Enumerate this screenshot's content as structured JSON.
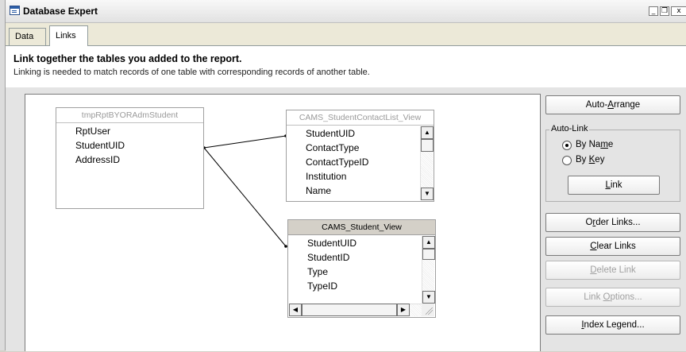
{
  "window": {
    "title": "Database Expert",
    "controls": {
      "minimize": "_",
      "restore": "❐",
      "close": "x"
    }
  },
  "tabs": [
    {
      "label": "Data",
      "active": false
    },
    {
      "label": "Links",
      "active": true
    }
  ],
  "heading": "Link together the tables you added to the report.",
  "subtext": "Linking is needed to match records of one table with corresponding records of another table.",
  "tables": [
    {
      "title": "tmpRptBYORAdmStudent",
      "fields": [
        "RptUser",
        "StudentUID",
        "AddressID"
      ]
    },
    {
      "title": "CAMS_StudentContactList_View",
      "fields": [
        "StudentUID",
        "ContactType",
        "ContactTypeID",
        "Institution",
        "Name"
      ]
    },
    {
      "title": "CAMS_Student_View",
      "fields": [
        "StudentUID",
        "StudentID",
        "Type",
        "TypeID"
      ]
    }
  ],
  "buttons": {
    "auto_arrange": {
      "pre": "Auto-",
      "key": "A",
      "post": "rrange"
    },
    "link": {
      "pre": "",
      "key": "L",
      "post": "ink"
    },
    "order_links": {
      "pre": "O",
      "key": "r",
      "post": "der Links..."
    },
    "clear_links": {
      "pre": "",
      "key": "C",
      "post": "lear Links"
    },
    "delete_link": {
      "pre": "",
      "key": "D",
      "post": "elete Link"
    },
    "link_options": {
      "pre": "Link ",
      "key": "O",
      "post": "ptions..."
    },
    "index_legend": {
      "pre": "",
      "key": "I",
      "post": "ndex Legend..."
    }
  },
  "auto_link": {
    "label": "Auto-Link",
    "options": [
      {
        "pre": "By Na",
        "key": "m",
        "post": "e",
        "selected": true
      },
      {
        "pre": "By ",
        "key": "K",
        "post": "ey",
        "selected": false
      }
    ]
  },
  "colors": {
    "accent": "#2c5ea8",
    "disabled_text": "#a0a0a0"
  },
  "icons": [
    "app-window-icon",
    "scroll-up-arrow-icon",
    "scroll-down-arrow-icon",
    "scroll-left-arrow-icon",
    "scroll-right-arrow-icon",
    "resize-grip-icon"
  ]
}
